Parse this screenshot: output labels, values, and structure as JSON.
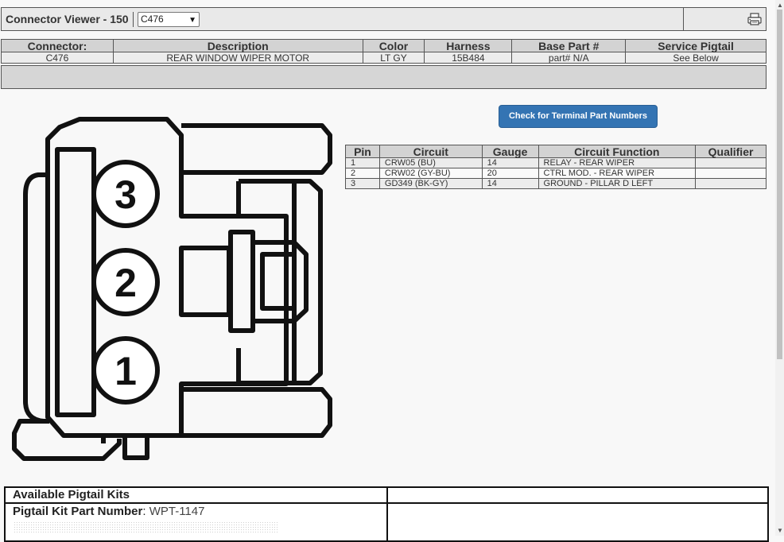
{
  "header": {
    "title": "Connector Viewer - 150",
    "selected_connector": "C476",
    "print_icon": "printer-icon"
  },
  "info_table": {
    "columns": [
      "Connector:",
      "Description",
      "Color",
      "Harness",
      "Base Part #",
      "Service Pigtail"
    ],
    "row": [
      "C476",
      "REAR WINDOW WIPER MOTOR",
      "LT GY",
      "15B484",
      "part# N/A",
      "See Below"
    ]
  },
  "terminal_button": {
    "label": "Check for Terminal Part Numbers"
  },
  "pin_table": {
    "columns": [
      "Pin",
      "Circuit",
      "Gauge",
      "Circuit Function",
      "Qualifier"
    ],
    "rows": [
      [
        "1",
        "CRW05 (BU)",
        "14",
        "RELAY - REAR WIPER",
        ""
      ],
      [
        "2",
        "CRW02 (GY-BU)",
        "20",
        "CTRL MOD. - REAR WIPER",
        ""
      ],
      [
        "3",
        "GD349 (BK-GY)",
        "14",
        "GROUND - PILLAR D LEFT",
        ""
      ]
    ]
  },
  "diagram": {
    "pins": [
      "3",
      "2",
      "1"
    ]
  },
  "pigtail": {
    "heading": "Available Pigtail Kits",
    "kit_label": "Pigtail Kit Part Number",
    "kit_value": "WPT-1147"
  },
  "colors": {
    "button": "#3474b3",
    "header_bg": "#d3d3d3"
  }
}
